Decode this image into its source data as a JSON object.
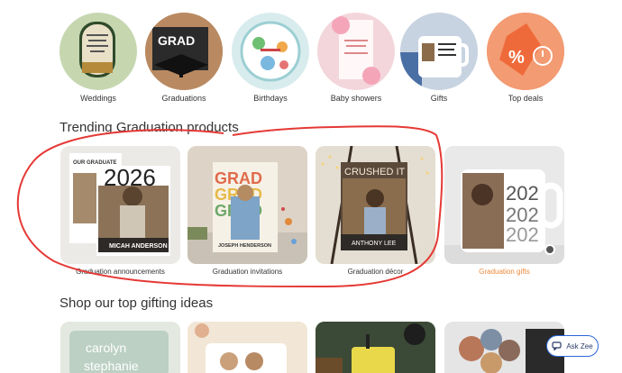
{
  "categories": [
    {
      "label": "Weddings"
    },
    {
      "label": "Graduations"
    },
    {
      "label": "Birthdays"
    },
    {
      "label": "Baby showers"
    },
    {
      "label": "Gifts"
    },
    {
      "label": "Top deals"
    }
  ],
  "trending": {
    "title": "Trending Graduation products",
    "items": [
      {
        "label": "Graduation announcements",
        "card_year": "2026",
        "card_name": "MICAH ANDERSON",
        "card_top": "OUR GRADUATE"
      },
      {
        "label": "Graduation invitations",
        "card_word": "GRAD",
        "card_name": "JOSEPH HENDERSON"
      },
      {
        "label": "Graduation décor",
        "card_word": "CRUSHED IT",
        "card_name": "ANTHONY LEE"
      },
      {
        "label": "Graduation gifts",
        "mug_text": "202"
      }
    ]
  },
  "gifting": {
    "title": "Shop our top gifting ideas",
    "pillow_text_1": "carolyn",
    "pillow_text_2": "stephanie"
  },
  "ask_zee": {
    "label": "Ask Zee"
  },
  "colors": {
    "accent": "#f08a3c",
    "annotation": "#e53935",
    "ask_zee_border": "#2b65d9"
  }
}
